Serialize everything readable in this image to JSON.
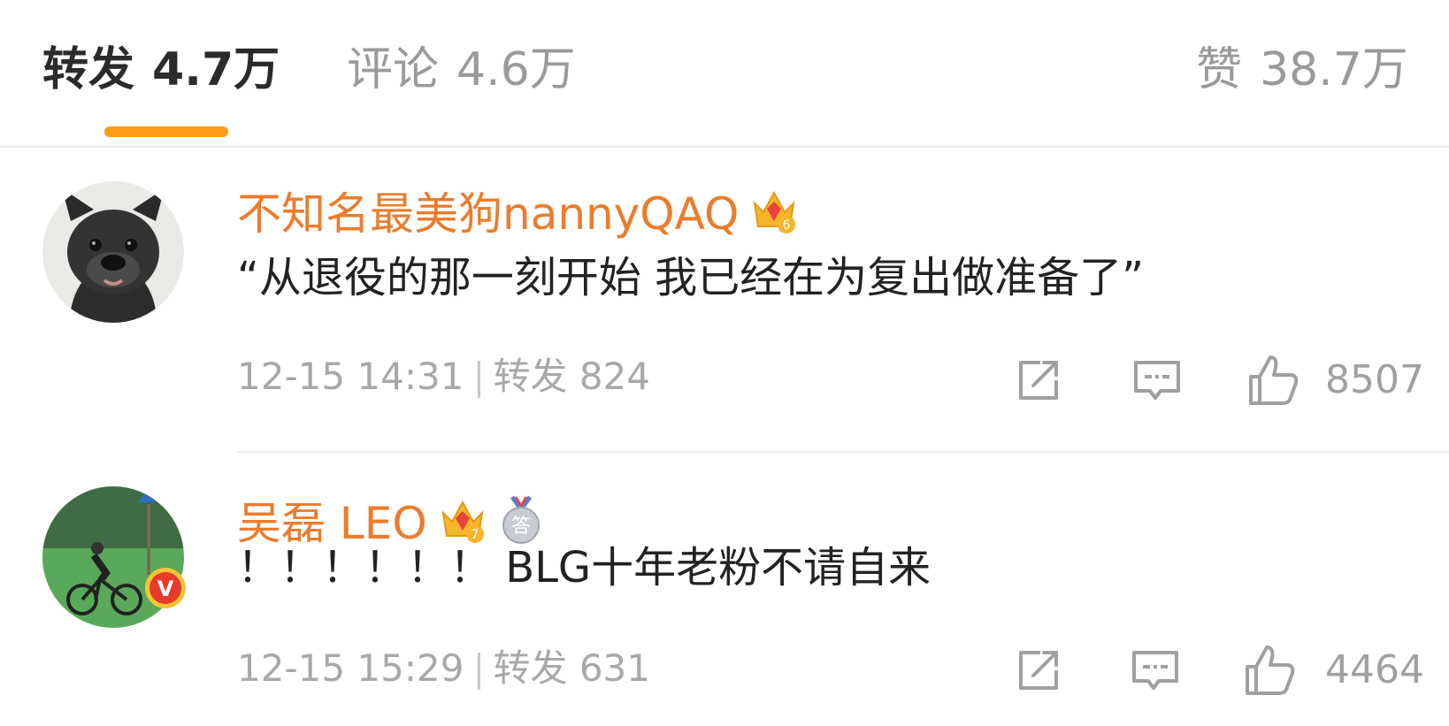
{
  "tabs": {
    "repost": {
      "label": "转发",
      "count": "4.7万"
    },
    "comment": {
      "label": "评论",
      "count": "4.6万"
    },
    "like": {
      "label": "赞",
      "count": "38.7万"
    }
  },
  "accent_color": "#fb9b18",
  "username_color": "#eb7c2c",
  "posts": [
    {
      "username": "不知名最美狗nannyQAQ",
      "badges": [
        "crown-icon"
      ],
      "crown_level": "6",
      "text": "“从退役的那一刻开始 我已经在为复出做准备了”",
      "time": "12-15 14:31",
      "repost_label": "转发",
      "repost_count": "824",
      "likes": "8507"
    },
    {
      "username": "吴磊 LEO",
      "badges": [
        "crown-icon",
        "answer-medal-icon"
      ],
      "crown_level": "7",
      "medal_text": "答",
      "verified_mark": "V",
      "text": "！！！！！！ BLG十年老粉不请自来",
      "time": "12-15 15:29",
      "repost_label": "转发",
      "repost_count": "631",
      "likes": "4464"
    }
  ]
}
